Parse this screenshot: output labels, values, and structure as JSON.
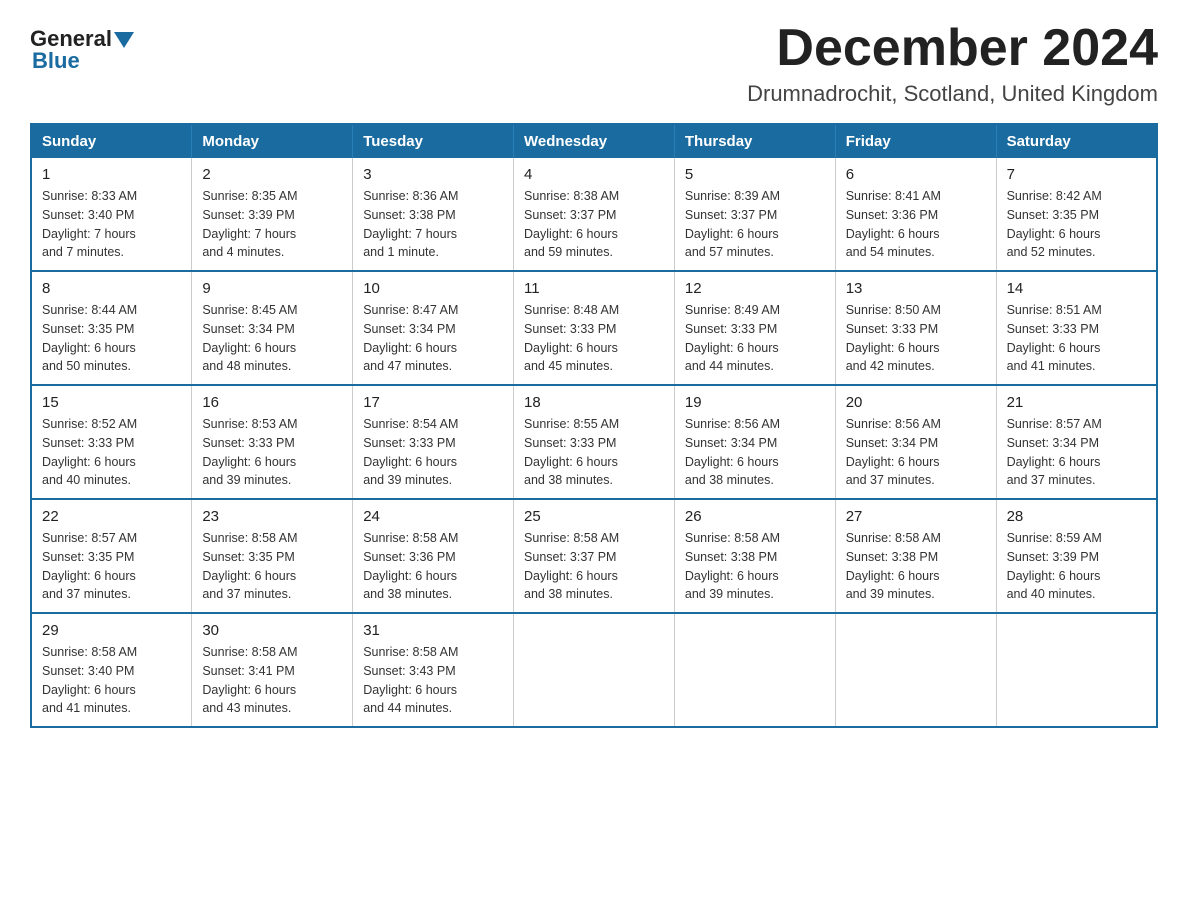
{
  "logo": {
    "general": "General",
    "blue": "Blue"
  },
  "title": "December 2024",
  "subtitle": "Drumnadrochit, Scotland, United Kingdom",
  "days_of_week": [
    "Sunday",
    "Monday",
    "Tuesday",
    "Wednesday",
    "Thursday",
    "Friday",
    "Saturday"
  ],
  "weeks": [
    [
      {
        "day": "1",
        "sunrise": "Sunrise: 8:33 AM",
        "sunset": "Sunset: 3:40 PM",
        "daylight": "Daylight: 7 hours",
        "daylight2": "and 7 minutes."
      },
      {
        "day": "2",
        "sunrise": "Sunrise: 8:35 AM",
        "sunset": "Sunset: 3:39 PM",
        "daylight": "Daylight: 7 hours",
        "daylight2": "and 4 minutes."
      },
      {
        "day": "3",
        "sunrise": "Sunrise: 8:36 AM",
        "sunset": "Sunset: 3:38 PM",
        "daylight": "Daylight: 7 hours",
        "daylight2": "and 1 minute."
      },
      {
        "day": "4",
        "sunrise": "Sunrise: 8:38 AM",
        "sunset": "Sunset: 3:37 PM",
        "daylight": "Daylight: 6 hours",
        "daylight2": "and 59 minutes."
      },
      {
        "day": "5",
        "sunrise": "Sunrise: 8:39 AM",
        "sunset": "Sunset: 3:37 PM",
        "daylight": "Daylight: 6 hours",
        "daylight2": "and 57 minutes."
      },
      {
        "day": "6",
        "sunrise": "Sunrise: 8:41 AM",
        "sunset": "Sunset: 3:36 PM",
        "daylight": "Daylight: 6 hours",
        "daylight2": "and 54 minutes."
      },
      {
        "day": "7",
        "sunrise": "Sunrise: 8:42 AM",
        "sunset": "Sunset: 3:35 PM",
        "daylight": "Daylight: 6 hours",
        "daylight2": "and 52 minutes."
      }
    ],
    [
      {
        "day": "8",
        "sunrise": "Sunrise: 8:44 AM",
        "sunset": "Sunset: 3:35 PM",
        "daylight": "Daylight: 6 hours",
        "daylight2": "and 50 minutes."
      },
      {
        "day": "9",
        "sunrise": "Sunrise: 8:45 AM",
        "sunset": "Sunset: 3:34 PM",
        "daylight": "Daylight: 6 hours",
        "daylight2": "and 48 minutes."
      },
      {
        "day": "10",
        "sunrise": "Sunrise: 8:47 AM",
        "sunset": "Sunset: 3:34 PM",
        "daylight": "Daylight: 6 hours",
        "daylight2": "and 47 minutes."
      },
      {
        "day": "11",
        "sunrise": "Sunrise: 8:48 AM",
        "sunset": "Sunset: 3:33 PM",
        "daylight": "Daylight: 6 hours",
        "daylight2": "and 45 minutes."
      },
      {
        "day": "12",
        "sunrise": "Sunrise: 8:49 AM",
        "sunset": "Sunset: 3:33 PM",
        "daylight": "Daylight: 6 hours",
        "daylight2": "and 44 minutes."
      },
      {
        "day": "13",
        "sunrise": "Sunrise: 8:50 AM",
        "sunset": "Sunset: 3:33 PM",
        "daylight": "Daylight: 6 hours",
        "daylight2": "and 42 minutes."
      },
      {
        "day": "14",
        "sunrise": "Sunrise: 8:51 AM",
        "sunset": "Sunset: 3:33 PM",
        "daylight": "Daylight: 6 hours",
        "daylight2": "and 41 minutes."
      }
    ],
    [
      {
        "day": "15",
        "sunrise": "Sunrise: 8:52 AM",
        "sunset": "Sunset: 3:33 PM",
        "daylight": "Daylight: 6 hours",
        "daylight2": "and 40 minutes."
      },
      {
        "day": "16",
        "sunrise": "Sunrise: 8:53 AM",
        "sunset": "Sunset: 3:33 PM",
        "daylight": "Daylight: 6 hours",
        "daylight2": "and 39 minutes."
      },
      {
        "day": "17",
        "sunrise": "Sunrise: 8:54 AM",
        "sunset": "Sunset: 3:33 PM",
        "daylight": "Daylight: 6 hours",
        "daylight2": "and 39 minutes."
      },
      {
        "day": "18",
        "sunrise": "Sunrise: 8:55 AM",
        "sunset": "Sunset: 3:33 PM",
        "daylight": "Daylight: 6 hours",
        "daylight2": "and 38 minutes."
      },
      {
        "day": "19",
        "sunrise": "Sunrise: 8:56 AM",
        "sunset": "Sunset: 3:34 PM",
        "daylight": "Daylight: 6 hours",
        "daylight2": "and 38 minutes."
      },
      {
        "day": "20",
        "sunrise": "Sunrise: 8:56 AM",
        "sunset": "Sunset: 3:34 PM",
        "daylight": "Daylight: 6 hours",
        "daylight2": "and 37 minutes."
      },
      {
        "day": "21",
        "sunrise": "Sunrise: 8:57 AM",
        "sunset": "Sunset: 3:34 PM",
        "daylight": "Daylight: 6 hours",
        "daylight2": "and 37 minutes."
      }
    ],
    [
      {
        "day": "22",
        "sunrise": "Sunrise: 8:57 AM",
        "sunset": "Sunset: 3:35 PM",
        "daylight": "Daylight: 6 hours",
        "daylight2": "and 37 minutes."
      },
      {
        "day": "23",
        "sunrise": "Sunrise: 8:58 AM",
        "sunset": "Sunset: 3:35 PM",
        "daylight": "Daylight: 6 hours",
        "daylight2": "and 37 minutes."
      },
      {
        "day": "24",
        "sunrise": "Sunrise: 8:58 AM",
        "sunset": "Sunset: 3:36 PM",
        "daylight": "Daylight: 6 hours",
        "daylight2": "and 38 minutes."
      },
      {
        "day": "25",
        "sunrise": "Sunrise: 8:58 AM",
        "sunset": "Sunset: 3:37 PM",
        "daylight": "Daylight: 6 hours",
        "daylight2": "and 38 minutes."
      },
      {
        "day": "26",
        "sunrise": "Sunrise: 8:58 AM",
        "sunset": "Sunset: 3:38 PM",
        "daylight": "Daylight: 6 hours",
        "daylight2": "and 39 minutes."
      },
      {
        "day": "27",
        "sunrise": "Sunrise: 8:58 AM",
        "sunset": "Sunset: 3:38 PM",
        "daylight": "Daylight: 6 hours",
        "daylight2": "and 39 minutes."
      },
      {
        "day": "28",
        "sunrise": "Sunrise: 8:59 AM",
        "sunset": "Sunset: 3:39 PM",
        "daylight": "Daylight: 6 hours",
        "daylight2": "and 40 minutes."
      }
    ],
    [
      {
        "day": "29",
        "sunrise": "Sunrise: 8:58 AM",
        "sunset": "Sunset: 3:40 PM",
        "daylight": "Daylight: 6 hours",
        "daylight2": "and 41 minutes."
      },
      {
        "day": "30",
        "sunrise": "Sunrise: 8:58 AM",
        "sunset": "Sunset: 3:41 PM",
        "daylight": "Daylight: 6 hours",
        "daylight2": "and 43 minutes."
      },
      {
        "day": "31",
        "sunrise": "Sunrise: 8:58 AM",
        "sunset": "Sunset: 3:43 PM",
        "daylight": "Daylight: 6 hours",
        "daylight2": "and 44 minutes."
      },
      null,
      null,
      null,
      null
    ]
  ]
}
